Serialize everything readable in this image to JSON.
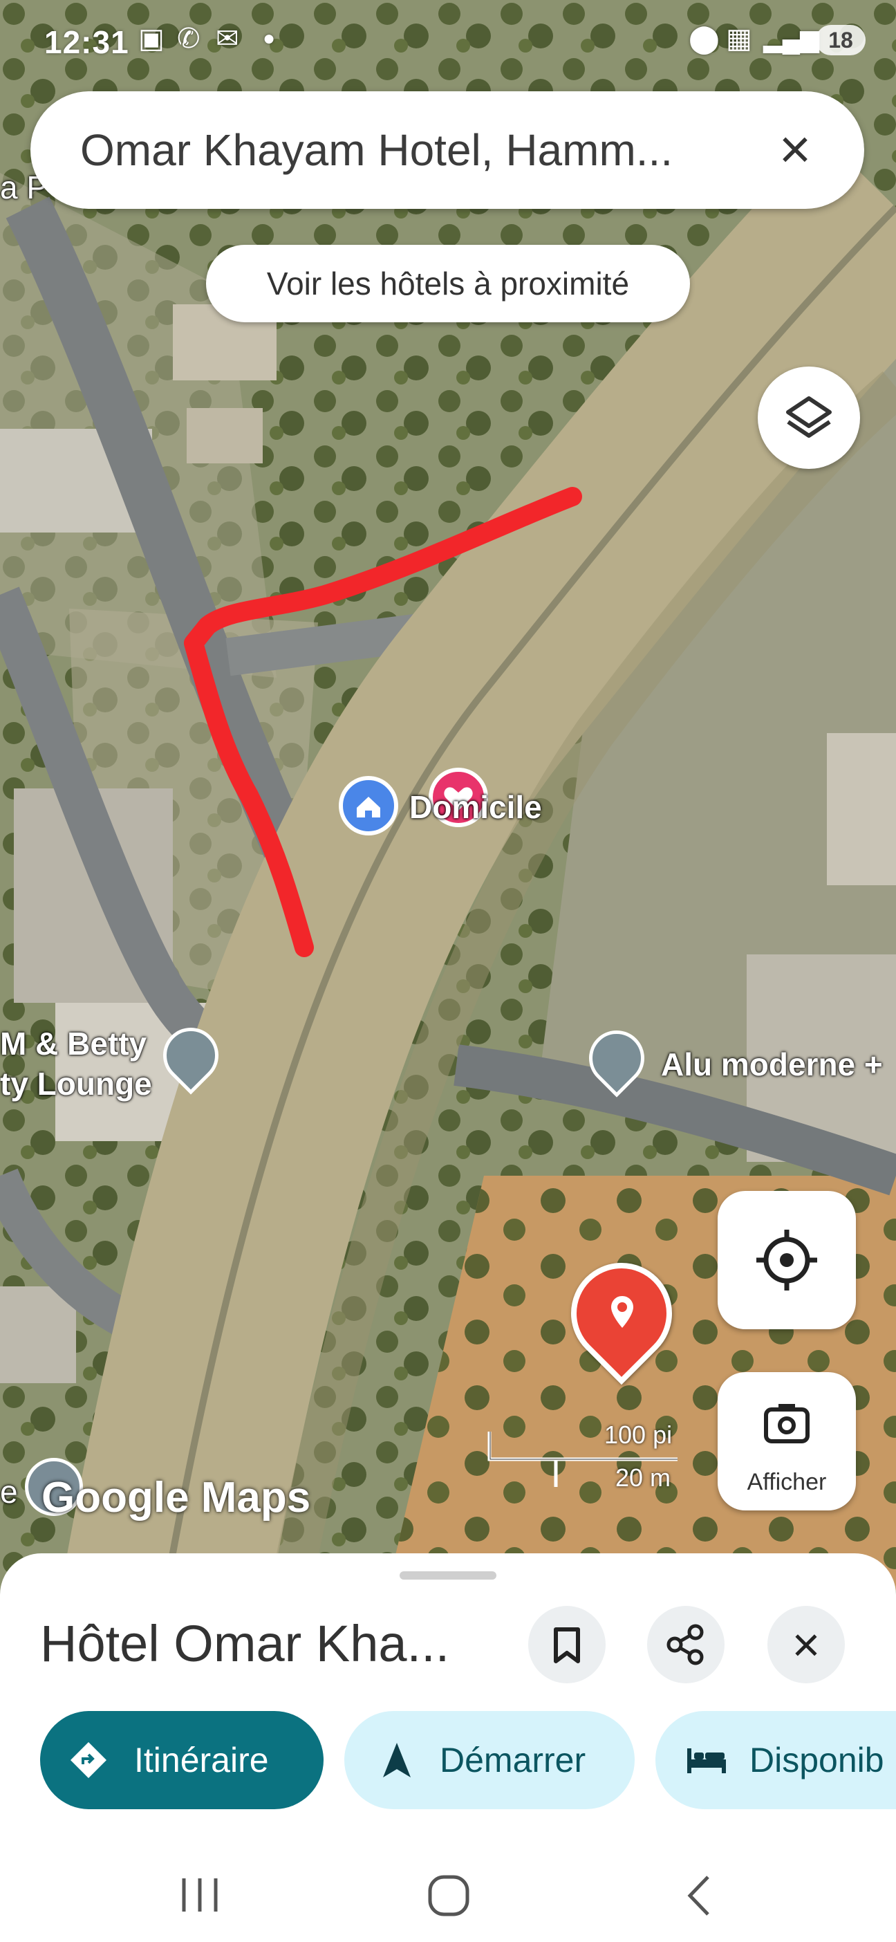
{
  "status_bar": {
    "time": "12:31",
    "battery": "18"
  },
  "search": {
    "query": "Omar Khayam Hotel, Hamm...",
    "clear_icon": "close-icon"
  },
  "nearby_button": {
    "label": "Voir les hôtels à proximité"
  },
  "map": {
    "labels": {
      "home": "Domicile",
      "place1_line1": "M & Betty",
      "place1_line2": "ty Lounge",
      "place2": "Alu moderne +",
      "left_cut_top": "a P",
      "left_cut_bottom": "e"
    },
    "scale": {
      "imperial": "100 pi",
      "metric": "20 m"
    },
    "logo": "Google Maps",
    "my_location_icon": "crosshair-icon",
    "layers_icon": "layers-icon",
    "afficher_label": "Afficher"
  },
  "sheet": {
    "title": "Hôtel Omar Kha...",
    "save_icon": "bookmark-icon",
    "share_icon": "share-icon",
    "close_icon": "close-icon",
    "chips": [
      {
        "label": "Itinéraire",
        "icon": "directions-icon"
      },
      {
        "label": "Démarrer",
        "icon": "navigation-arrow-icon"
      },
      {
        "label": "Disponib",
        "icon": "bed-icon"
      }
    ]
  },
  "colors": {
    "accent": "#0b7280",
    "chip_light": "#d6f3fb",
    "pin_red": "#ea4335",
    "route_red": "#f2262a"
  }
}
